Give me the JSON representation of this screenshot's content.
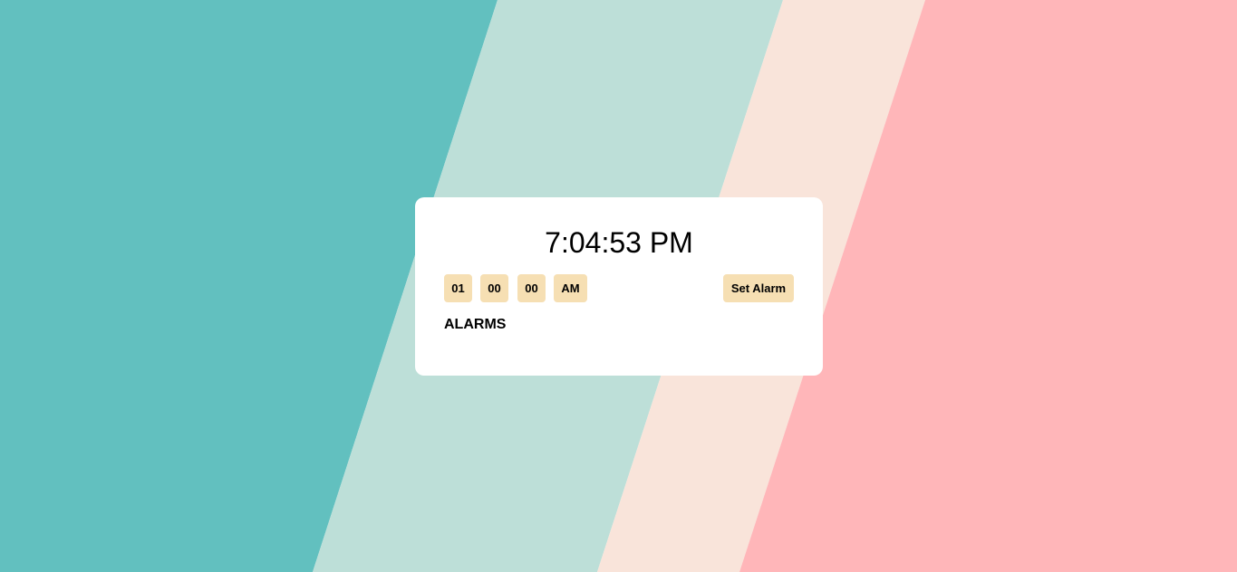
{
  "colors": {
    "stripe_1": "#62c0bf",
    "stripe_2": "#bddfd8",
    "stripe_3": "#f9e4da",
    "stripe_4": "#ffb6b9",
    "card_bg": "#ffffff",
    "pill_bg": "#f6dfb3",
    "text": "#000000"
  },
  "clock": {
    "time": "7:04:53 PM"
  },
  "controls": {
    "hour": "01",
    "minute": "00",
    "second": "00",
    "ampm": "AM",
    "set_alarm_label": "Set Alarm"
  },
  "alarms": {
    "heading": "ALARMS",
    "items": []
  }
}
